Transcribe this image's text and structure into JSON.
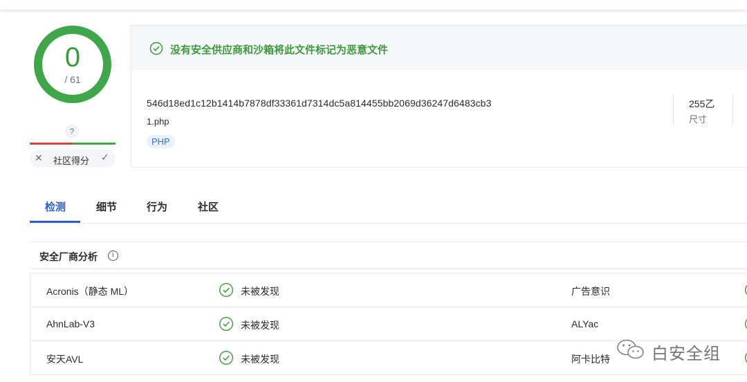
{
  "score": {
    "detections": "0",
    "total": "/ 61",
    "ring_color": "#3fa64a"
  },
  "community": {
    "badge": "?",
    "label": "社区得分",
    "downvote_icon": "close-icon",
    "upvote_icon": "check-icon"
  },
  "banner": {
    "icon": "check-circle-icon",
    "text": "没有安全供应商和沙箱将此文件标记为恶意文件",
    "color": "#3c9a3c"
  },
  "file": {
    "hash": "546d18ed1c12b1414b7878df33361d7314dc5a814455bb2069d36247d6483cb3",
    "name": "1.php",
    "tag": "PHP",
    "size_value": "255乙",
    "size_label": "尺寸"
  },
  "tabs": [
    {
      "label": "检测",
      "active": true
    },
    {
      "label": "细节",
      "active": false
    },
    {
      "label": "行为",
      "active": false
    },
    {
      "label": "社区",
      "active": false
    }
  ],
  "section": {
    "title": "安全厂商分析",
    "info_icon": "info-icon"
  },
  "vendors": [
    {
      "left": "Acronis（静态 ML）",
      "left_status": "未被发现",
      "right": "广告意识"
    },
    {
      "left": "AhnLab-V3",
      "left_status": "未被发现",
      "right": "ALYac"
    },
    {
      "left": "安天AVL",
      "left_status": "未被发现",
      "right": "阿卡比特"
    }
  ],
  "watermark": {
    "text": "白安全组",
    "icon": "wechat-icon"
  },
  "colors": {
    "accent": "#2b5fd1",
    "clean": "#3c9a3c",
    "negative": "#d64343"
  }
}
